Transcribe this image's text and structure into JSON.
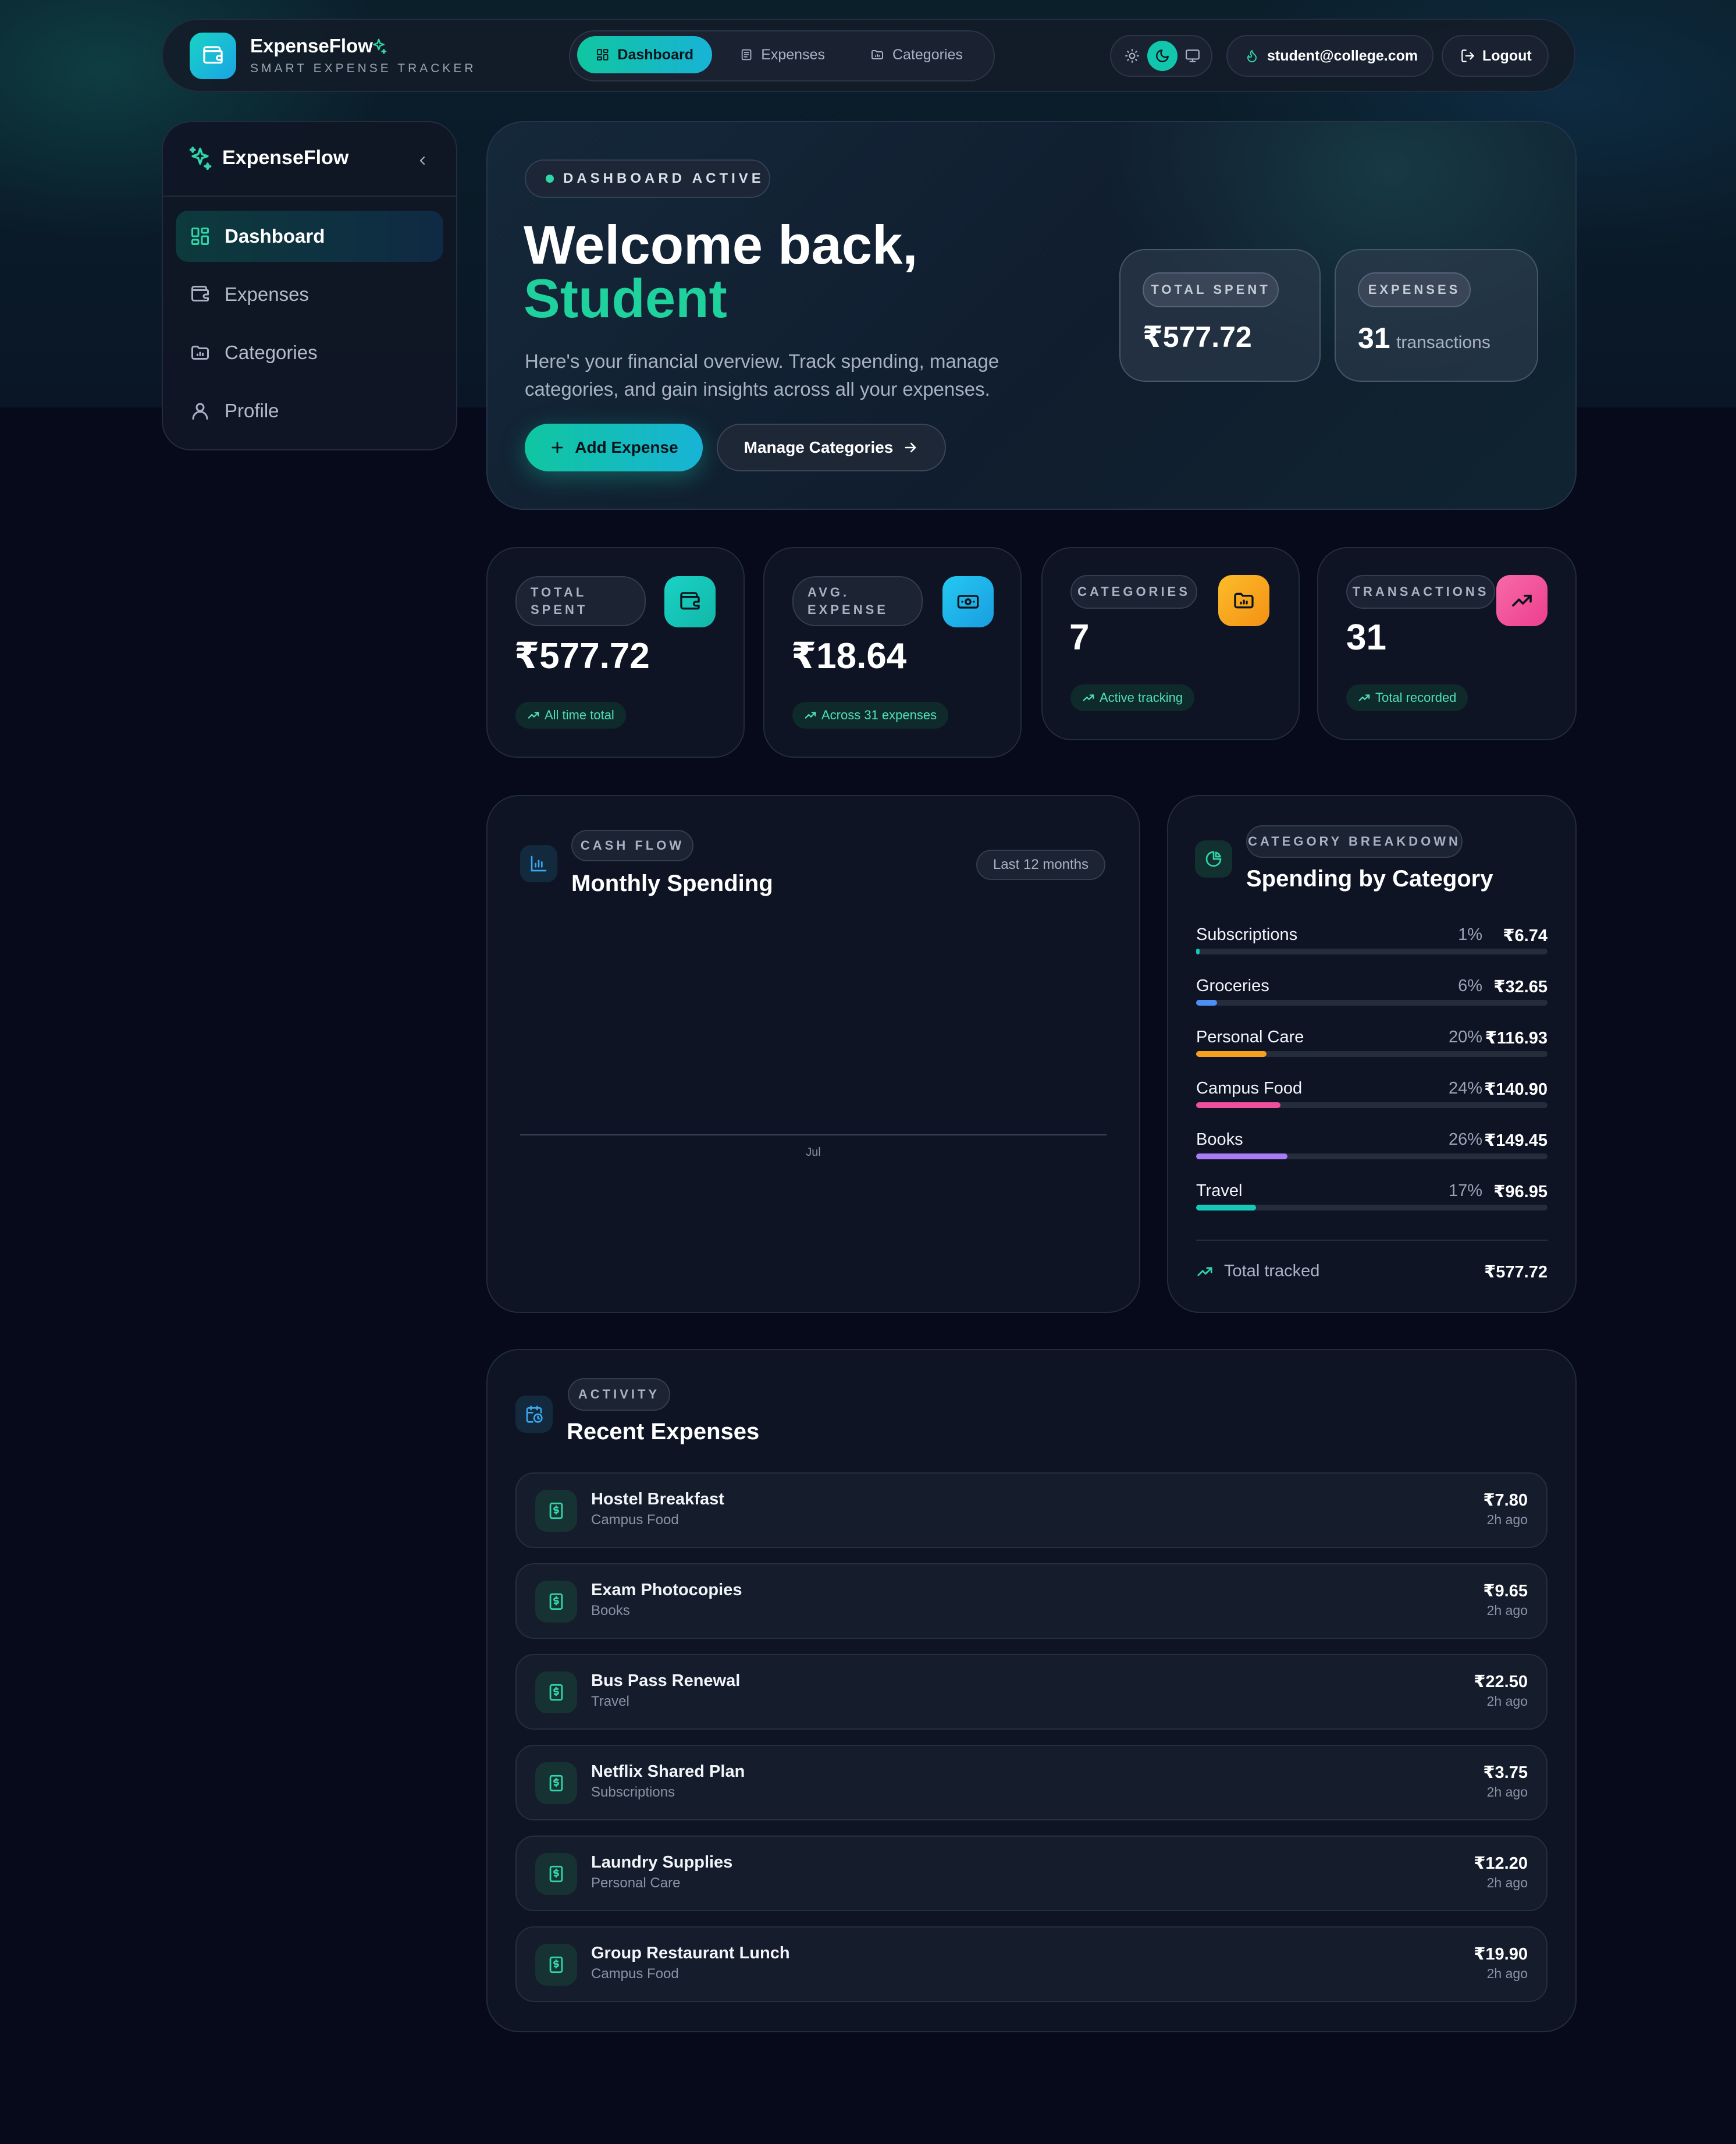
{
  "app": {
    "name": "ExpenseFlow",
    "tagline": "SMART EXPENSE TRACKER"
  },
  "topnav": {
    "tabs": [
      {
        "label": "Dashboard",
        "icon": "dashboard-icon",
        "active": true
      },
      {
        "label": "Expenses",
        "icon": "receipt-icon",
        "active": false
      },
      {
        "label": "Categories",
        "icon": "folder-icon",
        "active": false
      }
    ],
    "theme_modes": [
      "light",
      "dark",
      "system"
    ],
    "active_theme": "dark",
    "user_email": "student@college.com",
    "logout_label": "Logout"
  },
  "sidebar": {
    "brand": "ExpenseFlow",
    "items": [
      {
        "label": "Dashboard",
        "icon": "dashboard-icon",
        "active": true
      },
      {
        "label": "Expenses",
        "icon": "wallet-icon",
        "active": false
      },
      {
        "label": "Categories",
        "icon": "folder-chart-icon",
        "active": false
      },
      {
        "label": "Profile",
        "icon": "user-icon",
        "active": false
      }
    ]
  },
  "hero": {
    "status": "DASHBOARD ACTIVE",
    "greeting": "Welcome back,",
    "name": "Student",
    "description_line1": "Here's your financial overview. Track spending, manage",
    "description_line2": "categories, and gain insights across all your expenses.",
    "add_button": "Add Expense",
    "manage_button": "Manage Categories",
    "mini_total_label": "TOTAL SPENT",
    "mini_total_value": "₹577.72",
    "mini_expenses_label": "EXPENSES",
    "mini_expenses_count": "31",
    "mini_expenses_unit": "transactions"
  },
  "stats": [
    {
      "label_line1": "TOTAL",
      "label_line2": "SPENT",
      "value": "₹577.72",
      "badge": "All time total",
      "icon": "wallet-icon",
      "color": "#14c9b8"
    },
    {
      "label_line1": "AVG.",
      "label_line2": "EXPENSE",
      "value": "₹18.64",
      "badge": "Across 31 expenses",
      "icon": "banknote-icon",
      "color": "#1fb8f0"
    },
    {
      "label_line1": "CATEGORIES",
      "label_line2": "",
      "value": "7",
      "badge": "Active tracking",
      "icon": "folder-chart-icon",
      "color": "#f7a01e"
    },
    {
      "label_line1": "TRANSACTIONS",
      "label_line2": "",
      "value": "31",
      "badge": "Total recorded",
      "icon": "trending-up-icon",
      "color": "#f04e9e"
    }
  ],
  "cashflow": {
    "chip": "CASH FLOW",
    "title": "Monthly Spending",
    "range": "Last 12 months",
    "chart_data": {
      "type": "bar",
      "categories": [
        "Jul"
      ],
      "values": [
        0
      ],
      "title": "Monthly Spending",
      "xlabel": "",
      "ylabel": "",
      "grid": false
    }
  },
  "breakdown": {
    "chip": "CATEGORY BREAKDOWN",
    "title": "Spending by Category",
    "items": [
      {
        "name": "Subscriptions",
        "pct_label": "1%",
        "pct": 1,
        "amount": "₹6.74",
        "color": "#14c9b8"
      },
      {
        "name": "Groceries",
        "pct_label": "6%",
        "pct": 6,
        "amount": "₹32.65",
        "color": "#4c8ff5"
      },
      {
        "name": "Personal Care",
        "pct_label": "20%",
        "pct": 20,
        "amount": "₹116.93",
        "color": "#f7a01e"
      },
      {
        "name": "Campus Food",
        "pct_label": "24%",
        "pct": 24,
        "amount": "₹140.90",
        "color": "#f04e9e"
      },
      {
        "name": "Books",
        "pct_label": "26%",
        "pct": 26,
        "amount": "₹149.45",
        "color": "#a97bf5"
      },
      {
        "name": "Travel",
        "pct_label": "17%",
        "pct": 17,
        "amount": "₹96.95",
        "color": "#14c9b8"
      }
    ],
    "total_label": "Total tracked",
    "total_value": "₹577.72"
  },
  "recent": {
    "chip": "ACTIVITY",
    "title": "Recent Expenses",
    "items": [
      {
        "title": "Hostel Breakfast",
        "category": "Campus Food",
        "amount": "₹7.80",
        "time": "2h ago"
      },
      {
        "title": "Exam Photocopies",
        "category": "Books",
        "amount": "₹9.65",
        "time": "2h ago"
      },
      {
        "title": "Bus Pass Renewal",
        "category": "Travel",
        "amount": "₹22.50",
        "time": "2h ago"
      },
      {
        "title": "Netflix Shared Plan",
        "category": "Subscriptions",
        "amount": "₹3.75",
        "time": "2h ago"
      },
      {
        "title": "Laundry Supplies",
        "category": "Personal Care",
        "amount": "₹12.20",
        "time": "2h ago"
      },
      {
        "title": "Group Restaurant Lunch",
        "category": "Campus Food",
        "amount": "₹19.90",
        "time": "2h ago"
      }
    ]
  }
}
